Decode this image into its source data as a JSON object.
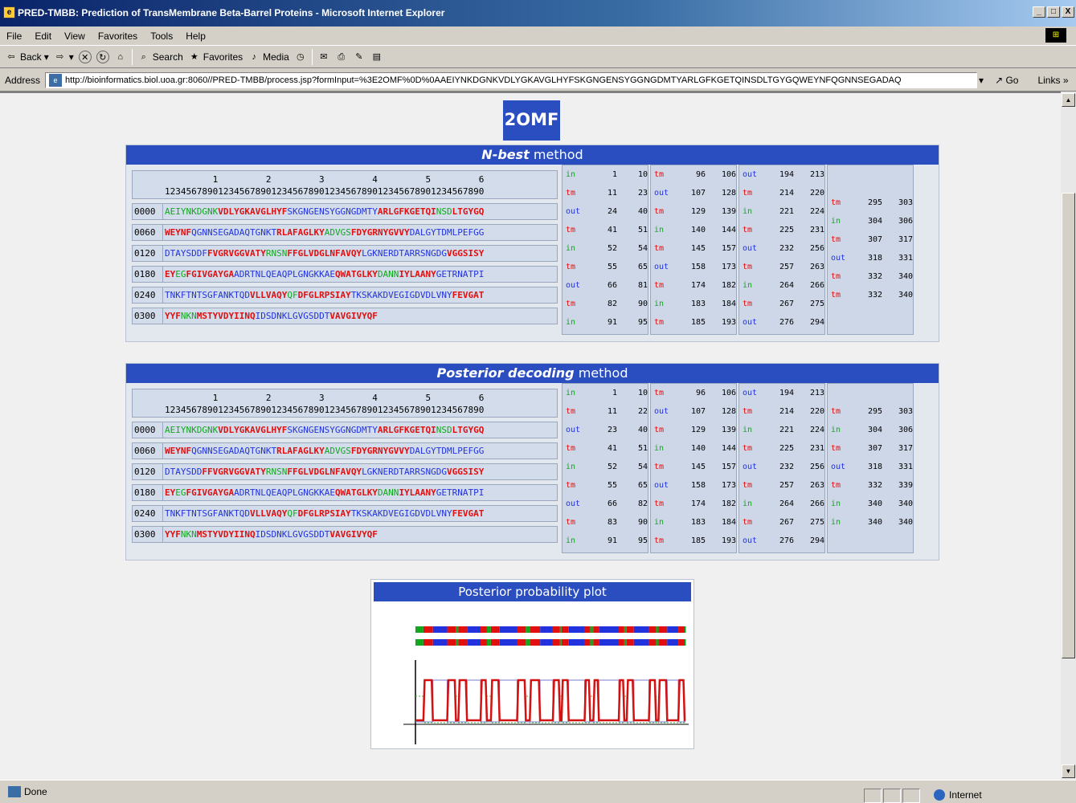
{
  "window": {
    "title": "PRED-TMBB: Prediction of TransMembrane Beta-Barrel Proteins - Microsoft Internet Explorer",
    "buttons": [
      "_",
      "□",
      "X"
    ]
  },
  "menu": [
    "File",
    "Edit",
    "View",
    "Favorites",
    "Tools",
    "Help"
  ],
  "toolbar": {
    "back": "Back",
    "search": "Search",
    "favorites": "Favorites",
    "media": "Media"
  },
  "address": {
    "label": "Address",
    "url": "http://bioinformatics.biol.uoa.gr:8060//PRED-TMBB/process.jsp?formInput=%3E2OMF%0D%0AAEIYNKDGNKVDLYGKAVGLHYFSKGNGENSYGGNGDMTYARLGFKGETQINSDLTGYGQWEYNFQGNNSEGADAQ",
    "go": "Go",
    "links": "Links"
  },
  "status": {
    "text": "Done",
    "zone": "Internet"
  },
  "protein": "2OMF",
  "ruler": {
    "tens": "         1         2         3         4         5         6",
    "ones": "123456789012345678901234567890123456789012345678901234567890"
  },
  "nbest": {
    "title_em": "N-best",
    "title_rest": " method",
    "rows": [
      {
        "num": "0000",
        "segs": [
          [
            "in",
            "AEIYNKDGNK"
          ],
          [
            "tm",
            "VDLYGKAVGLHYF"
          ],
          [
            "out",
            "SKGNGENSYGGNGDMTY"
          ],
          [
            "tm",
            "ARLGFKGETQI"
          ],
          [
            "in",
            "NSD"
          ],
          [
            "tm",
            "LTGYGQ"
          ]
        ]
      },
      {
        "num": "0060",
        "segs": [
          [
            "tm",
            "WEYNF"
          ],
          [
            "out",
            "QGNNSEGADAQTGNKT"
          ],
          [
            "tm",
            "RLAFAGLKY"
          ],
          [
            "in",
            "ADVGS"
          ],
          [
            "tm",
            "FDYGRNYGVVY"
          ],
          [
            "out",
            "DALGYTDMLPEFGG"
          ]
        ]
      },
      {
        "num": "0120",
        "segs": [
          [
            "out",
            "DTAYSDDF"
          ],
          [
            "tm",
            "FVGRVGGVATY"
          ],
          [
            "in",
            "RNSN"
          ],
          [
            "tm",
            "FFGLVDGLNFAVQY"
          ],
          [
            "out",
            "LGKNERDTARRSNGDG"
          ],
          [
            "tm",
            "VGGSISY"
          ]
        ]
      },
      {
        "num": "0180",
        "segs": [
          [
            "tm",
            "EY"
          ],
          [
            "in",
            "EG"
          ],
          [
            "tm",
            "FGIVGAYGA"
          ],
          [
            "out",
            "ADRTNLQEAQPLGNGKKAE"
          ],
          [
            "tm",
            "QWATGLKY"
          ],
          [
            "in",
            "DANN"
          ],
          [
            "tm",
            "IYLAANY"
          ],
          [
            "out",
            "GETRNATPI"
          ]
        ]
      },
      {
        "num": "0240",
        "segs": [
          [
            "out",
            "TNKFTNTSGFANKTQD"
          ],
          [
            "tm",
            "VLLVAQY"
          ],
          [
            "in",
            "QF"
          ],
          [
            "tm",
            "DFGLRPSIAY"
          ],
          [
            "out",
            "TKSKAKDVEGIGDVDLVNY"
          ],
          [
            "tm",
            "FEVGAT"
          ]
        ]
      },
      {
        "num": "0300",
        "segs": [
          [
            "tm",
            "YYF"
          ],
          [
            "in",
            "NKN"
          ],
          [
            "tm",
            "MSTYVDYIINQ"
          ],
          [
            "out",
            "IDSDNKLGVGSDDT"
          ],
          [
            "tm",
            "VAVGIVYQF"
          ]
        ]
      }
    ],
    "topology": [
      [
        [
          "in",
          "1",
          "10"
        ],
        [
          "tm",
          "11",
          "23"
        ],
        [
          "out",
          "24",
          "40"
        ],
        [
          "tm",
          "41",
          "51"
        ],
        [
          "in",
          "52",
          "54"
        ],
        [
          "tm",
          "55",
          "65"
        ],
        [
          "out",
          "66",
          "81"
        ],
        [
          "tm",
          "82",
          "90"
        ],
        [
          "in",
          "91",
          "95"
        ]
      ],
      [
        [
          "tm",
          "96",
          "106"
        ],
        [
          "out",
          "107",
          "128"
        ],
        [
          "tm",
          "129",
          "139"
        ],
        [
          "in",
          "140",
          "144"
        ],
        [
          "tm",
          "145",
          "157"
        ],
        [
          "out",
          "158",
          "173"
        ],
        [
          "tm",
          "174",
          "182"
        ],
        [
          "in",
          "183",
          "184"
        ],
        [
          "tm",
          "185",
          "193"
        ]
      ],
      [
        [
          "out",
          "194",
          "213"
        ],
        [
          "tm",
          "214",
          "220"
        ],
        [
          "in",
          "221",
          "224"
        ],
        [
          "tm",
          "225",
          "231"
        ],
        [
          "out",
          "232",
          "256"
        ],
        [
          "tm",
          "257",
          "263"
        ],
        [
          "in",
          "264",
          "266"
        ],
        [
          "tm",
          "267",
          "275"
        ],
        [
          "out",
          "276",
          "294"
        ]
      ],
      [
        [
          "tm",
          "295",
          "303"
        ],
        [
          "in",
          "304",
          "306"
        ],
        [
          "tm",
          "307",
          "317"
        ],
        [
          "out",
          "318",
          "331"
        ],
        [
          "tm",
          "332",
          "340"
        ],
        [
          "tm",
          "332",
          "340"
        ]
      ]
    ]
  },
  "posterior": {
    "title_em": "Posterior decoding",
    "title_rest": " method",
    "rows": [
      {
        "num": "0000",
        "segs": [
          [
            "in",
            "AEIYNKDGNK"
          ],
          [
            "tm",
            "VDLYGKAVGLHYF"
          ],
          [
            "out",
            "SKGNGENSYGGNGDMTY"
          ],
          [
            "tm",
            "ARLGFKGETQI"
          ],
          [
            "in",
            "NSD"
          ],
          [
            "tm",
            "LTGYGQ"
          ]
        ]
      },
      {
        "num": "0060",
        "segs": [
          [
            "tm",
            "WEYNF"
          ],
          [
            "out",
            "QGNNSEGADAQTGNKT"
          ],
          [
            "tm",
            "RLAFAGLKY"
          ],
          [
            "in",
            "ADVGS"
          ],
          [
            "tm",
            "FDYGRNYGVVY"
          ],
          [
            "out",
            "DALGYTDMLPEFGG"
          ]
        ]
      },
      {
        "num": "0120",
        "segs": [
          [
            "out",
            "DTAYSDD"
          ],
          [
            "tm",
            "FFVGRVGGVATY"
          ],
          [
            "in",
            "RNSN"
          ],
          [
            "tm",
            "FFGLVDGLNFAVQY"
          ],
          [
            "out",
            "LGKNERDTARRSNGDG"
          ],
          [
            "tm",
            "VGGSISY"
          ]
        ]
      },
      {
        "num": "0180",
        "segs": [
          [
            "tm",
            "EY"
          ],
          [
            "in",
            "EG"
          ],
          [
            "tm",
            "FGIVGAYGA"
          ],
          [
            "out",
            "ADRTNLQEAQPLGNGKKAE"
          ],
          [
            "tm",
            "QWATGLKY"
          ],
          [
            "in",
            "DANN"
          ],
          [
            "tm",
            "IYLAANY"
          ],
          [
            "out",
            "GETRNATPI"
          ]
        ]
      },
      {
        "num": "0240",
        "segs": [
          [
            "out",
            "TNKFTNTSGFANKTQD"
          ],
          [
            "tm",
            "VLLVAQY"
          ],
          [
            "in",
            "QF"
          ],
          [
            "tm",
            "DFGLRPSIAY"
          ],
          [
            "out",
            "TKSKAKDVEGIGDVDLVNY"
          ],
          [
            "tm",
            "FEVGAT"
          ]
        ]
      },
      {
        "num": "0300",
        "segs": [
          [
            "tm",
            "YYF"
          ],
          [
            "in",
            "NKN"
          ],
          [
            "tm",
            "MSTYVDYIINQ"
          ],
          [
            "out",
            "IDSDNKLGVGSDDT"
          ],
          [
            "tm",
            "VAVGIVYQF"
          ]
        ]
      }
    ],
    "topology": [
      [
        [
          "in",
          "1",
          "10"
        ],
        [
          "tm",
          "11",
          "22"
        ],
        [
          "out",
          "23",
          "40"
        ],
        [
          "tm",
          "41",
          "51"
        ],
        [
          "in",
          "52",
          "54"
        ],
        [
          "tm",
          "55",
          "65"
        ],
        [
          "out",
          "66",
          "82"
        ],
        [
          "tm",
          "83",
          "90"
        ],
        [
          "in",
          "91",
          "95"
        ]
      ],
      [
        [
          "tm",
          "96",
          "106"
        ],
        [
          "out",
          "107",
          "128"
        ],
        [
          "tm",
          "129",
          "139"
        ],
        [
          "in",
          "140",
          "144"
        ],
        [
          "tm",
          "145",
          "157"
        ],
        [
          "out",
          "158",
          "173"
        ],
        [
          "tm",
          "174",
          "182"
        ],
        [
          "in",
          "183",
          "184"
        ],
        [
          "tm",
          "185",
          "193"
        ]
      ],
      [
        [
          "out",
          "194",
          "213"
        ],
        [
          "tm",
          "214",
          "220"
        ],
        [
          "in",
          "221",
          "224"
        ],
        [
          "tm",
          "225",
          "231"
        ],
        [
          "out",
          "232",
          "256"
        ],
        [
          "tm",
          "257",
          "263"
        ],
        [
          "in",
          "264",
          "266"
        ],
        [
          "tm",
          "267",
          "275"
        ],
        [
          "out",
          "276",
          "294"
        ]
      ],
      [
        [
          "tm",
          "295",
          "303"
        ],
        [
          "in",
          "304",
          "306"
        ],
        [
          "tm",
          "307",
          "317"
        ],
        [
          "out",
          "318",
          "331"
        ],
        [
          "tm",
          "332",
          "339"
        ],
        [
          "in",
          "340",
          "340"
        ],
        [
          "in",
          "340",
          "340"
        ]
      ]
    ]
  },
  "plot": {
    "title": "Posterior probability plot"
  },
  "colors": {
    "in": "#12a81e",
    "out": "#2233dd",
    "tm": "#e01010",
    "header": "#2a4dc0"
  }
}
